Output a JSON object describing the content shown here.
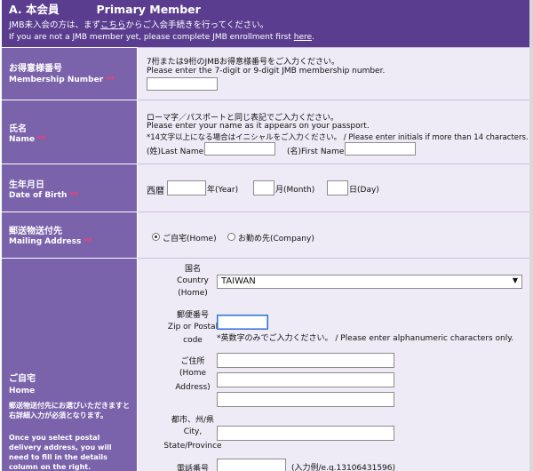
{
  "header": {
    "title_ja": "A.  本会員",
    "title_en": "Primary Member",
    "line1_pre": "JMB未入会の方は、まず",
    "line1_link": "こちら",
    "line1_post": "からご入会手続きを行ってください。",
    "line2_pre": "If you are not a JMB member yet, please complete JMB enrollment first ",
    "line2_link": "here",
    "line2_post": "."
  },
  "membership": {
    "label_ja": "お得意様番号",
    "label_en": "Membership Number",
    "req": "**",
    "note_ja": "7桁または9桁のJMBお得意様番号をご入力ください。",
    "note_en": "Please enter the 7-digit or 9-digit JMB membership number.",
    "value": ""
  },
  "name": {
    "label_ja": "氏名",
    "label_en": "Name",
    "req": "**",
    "note1": "ローマ字／パスポートと同じ表記でご入力ください。",
    "note2": "Please enter your name as it appears on your passport.",
    "note3": "*14文字以上になる場合はイニシャルをご入力ください。 / Please enter initials if more than 14 characters.",
    "last_label": "(姓)Last Name",
    "first_label": "(名)First Name",
    "last_value": "",
    "first_value": ""
  },
  "dob": {
    "label_ja": "生年月日",
    "label_en": "Date of Birth",
    "req": "**",
    "era": "西暦",
    "year": "年(Year)",
    "month": "月(Month)",
    "day": "日(Day)"
  },
  "mailing": {
    "label_ja": "郵送物送付先",
    "label_en": "Mailing Address",
    "req": "**",
    "opt_home": "ご自宅(Home)",
    "opt_company": "お勤め先(Company)",
    "selected": "home"
  },
  "home": {
    "label_ja": "ご自宅",
    "label_en": "Home",
    "note_ja": "郵送物送付先にお選びいただきますと右詳細入力が必須となります。",
    "note_en": "Once you select postal delivery address, you will need to fill in the details column on the right.",
    "country_ja": "国名",
    "country_en1": "Country",
    "country_en2": "(Home)",
    "country_value": "TAIWAN",
    "zip_ja": "郵便番号",
    "zip_en1": "Zip or Postal",
    "zip_en2": "code",
    "zip_note": "*英数字のみでご入力ください。 / Please enter alphanumeric characters only.",
    "addr_ja": "ご住所",
    "addr_en1": "(Home",
    "addr_en2": "Address)",
    "city_ja": "都市、州/県",
    "city_en1": "City,",
    "city_en2": "State/Province",
    "phone_ja": "電話番号",
    "phone_note": "(入力例/e.g.13106431596)"
  }
}
